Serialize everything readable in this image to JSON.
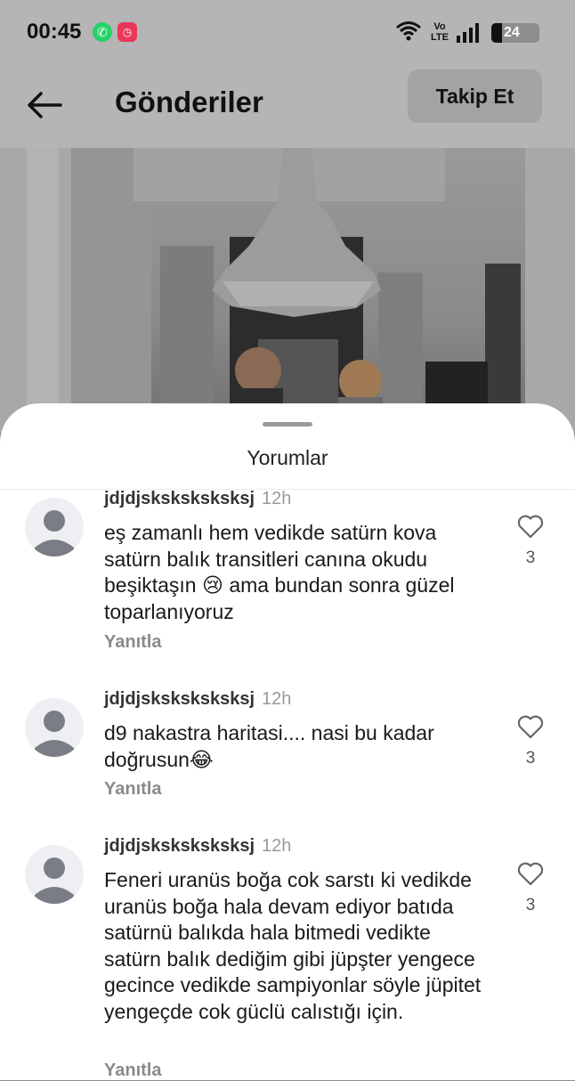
{
  "status": {
    "time": "00:45",
    "battery": "24"
  },
  "header": {
    "title": "Gönderiler",
    "follow_label": "Takip Et"
  },
  "sheet": {
    "title": "Yorumlar"
  },
  "comments": [
    {
      "username": "jdjdjsksksksksksj",
      "time": "12h",
      "text": "eş zamanlı hem vedikde satürn kova satürn balık transitleri canına okudu beşiktaşın 😢 ama bundan sonra güzel toparlanıyoruz",
      "likes": "3",
      "reply_label": "Yanıtla"
    },
    {
      "username": "jdjdjsksksksksksj",
      "time": "12h",
      "text": "d9 nakastra haritasi.... nasi bu kadar doğrusun😂",
      "likes": "3",
      "reply_label": "Yanıtla"
    },
    {
      "username": "jdjdjsksksksksksj",
      "time": "12h",
      "text": "Feneri uranüs boğa cok sarstı ki vedikde uranüs boğa hala devam ediyor batıda satürnü balıkda hala bitmedi vedikte satürn balık dediğim gibi jüpşter yengece gecince vedikde sampiyonlar söyle jüpitet yengeçde cok güclü calıstığı için.",
      "likes": "3",
      "reply_label": "Yanıtla"
    }
  ]
}
